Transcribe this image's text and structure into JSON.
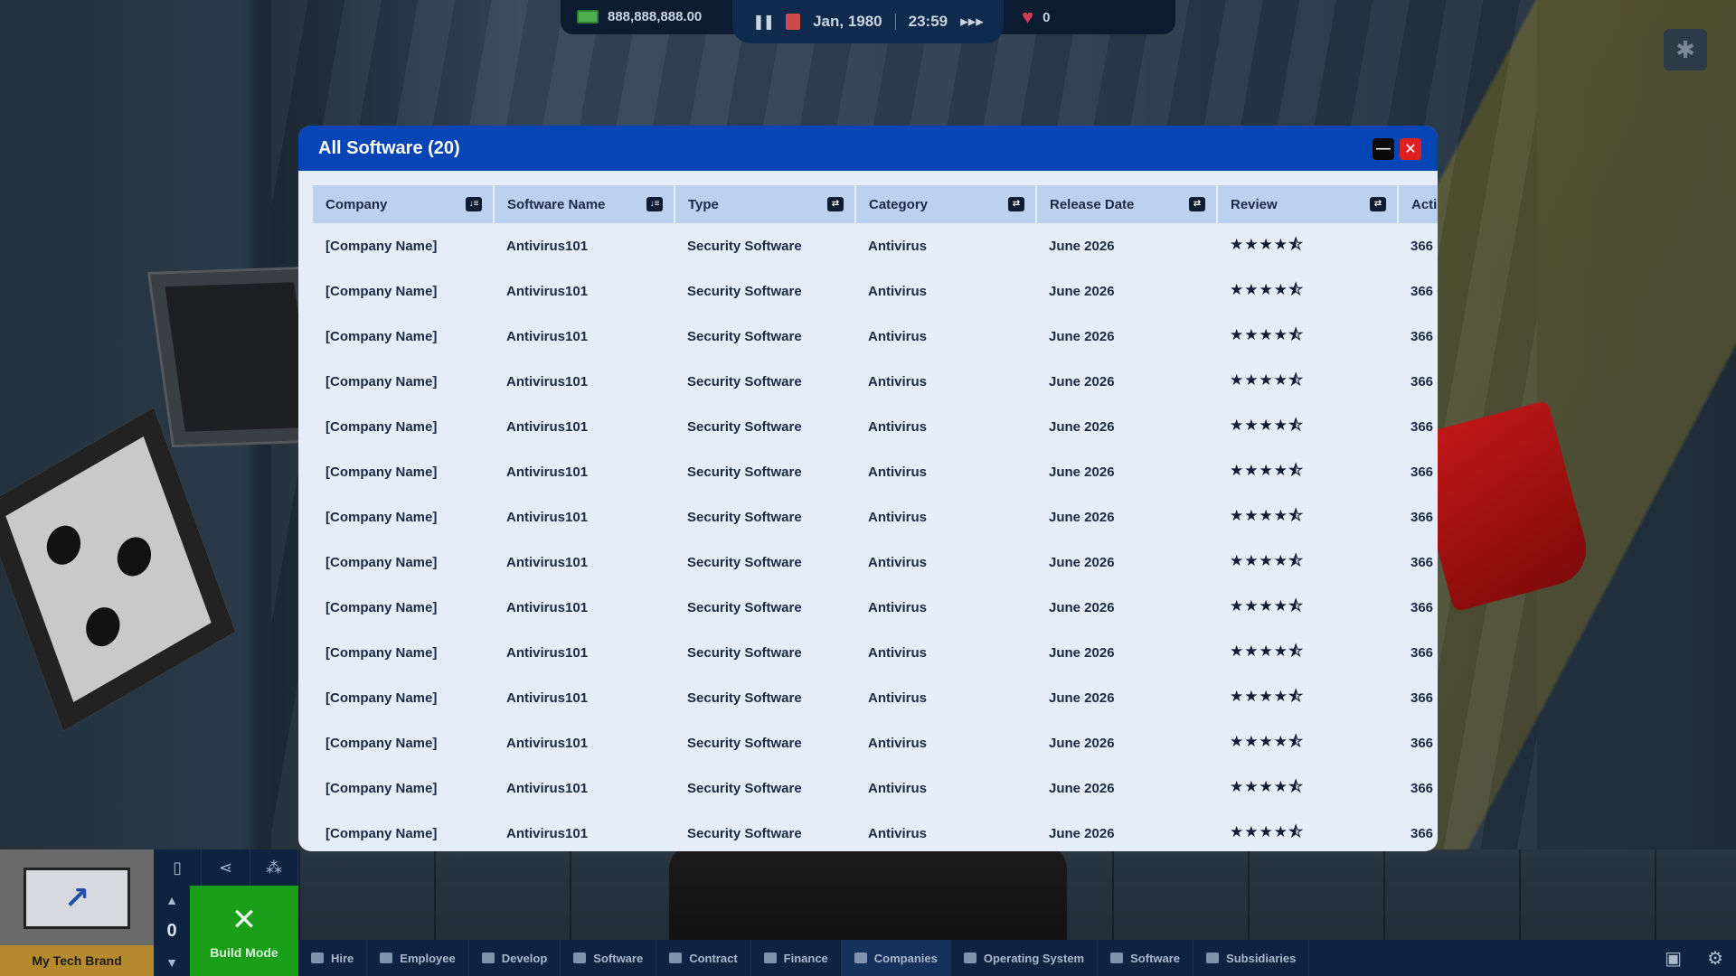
{
  "hud": {
    "money": "888,888,888.00",
    "date": "Jan, 1980",
    "time": "23:59",
    "fast_forward": "▸▸▸",
    "love": "0"
  },
  "dialog": {
    "title": "All Software (20)",
    "columns": [
      "Company",
      "Software Name",
      "Type",
      "Category",
      "Release Date",
      "Review",
      "Acti"
    ],
    "rows": [
      [
        "[Company Name]",
        "Antivirus101",
        "Security Software",
        "Antivirus",
        "June 2026",
        "★★★★⯪",
        "366"
      ],
      [
        "[Company Name]",
        "Antivirus101",
        "Security Software",
        "Antivirus",
        "June 2026",
        "★★★★⯪",
        "366"
      ],
      [
        "[Company Name]",
        "Antivirus101",
        "Security Software",
        "Antivirus",
        "June 2026",
        "★★★★⯪",
        "366"
      ],
      [
        "[Company Name]",
        "Antivirus101",
        "Security Software",
        "Antivirus",
        "June 2026",
        "★★★★⯪",
        "366"
      ],
      [
        "[Company Name]",
        "Antivirus101",
        "Security Software",
        "Antivirus",
        "June 2026",
        "★★★★⯪",
        "366"
      ],
      [
        "[Company Name]",
        "Antivirus101",
        "Security Software",
        "Antivirus",
        "June 2026",
        "★★★★⯪",
        "366"
      ],
      [
        "[Company Name]",
        "Antivirus101",
        "Security Software",
        "Antivirus",
        "June 2026",
        "★★★★⯪",
        "366"
      ],
      [
        "[Company Name]",
        "Antivirus101",
        "Security Software",
        "Antivirus",
        "June 2026",
        "★★★★⯪",
        "366"
      ],
      [
        "[Company Name]",
        "Antivirus101",
        "Security Software",
        "Antivirus",
        "June 2026",
        "★★★★⯪",
        "366"
      ],
      [
        "[Company Name]",
        "Antivirus101",
        "Security Software",
        "Antivirus",
        "June 2026",
        "★★★★⯪",
        "366"
      ],
      [
        "[Company Name]",
        "Antivirus101",
        "Security Software",
        "Antivirus",
        "June 2026",
        "★★★★⯪",
        "366"
      ],
      [
        "[Company Name]",
        "Antivirus101",
        "Security Software",
        "Antivirus",
        "June 2026",
        "★★★★⯪",
        "366"
      ],
      [
        "[Company Name]",
        "Antivirus101",
        "Security Software",
        "Antivirus",
        "June 2026",
        "★★★★⯪",
        "366"
      ],
      [
        "[Company Name]",
        "Antivirus101",
        "Security Software",
        "Antivirus",
        "June 2026",
        "★★★★⯪",
        "366"
      ]
    ],
    "review_rating": 4.5
  },
  "nav": {
    "items": [
      "Hire",
      "Employee",
      "Develop",
      "Software",
      "Contract",
      "Finance",
      "Companies",
      "Operating System",
      "Software",
      "Subsidiaries"
    ],
    "active_index": 6
  },
  "brand": {
    "name": "My Tech Brand",
    "floor": "0",
    "build_mode_label": "Build Mode"
  },
  "colors": {
    "header_blue": "#0645b6",
    "close_red": "#e02020",
    "build_green": "#1a9e1a",
    "brand_gold": "#b58a2e"
  },
  "icons": [
    "money-icon",
    "pause-icon",
    "calendar-icon",
    "fast-forward-icon",
    "heart-icon",
    "bug-icon",
    "minimize-icon",
    "close-icon",
    "sort-icon",
    "save-icon",
    "gear-icon",
    "tools-icon"
  ]
}
